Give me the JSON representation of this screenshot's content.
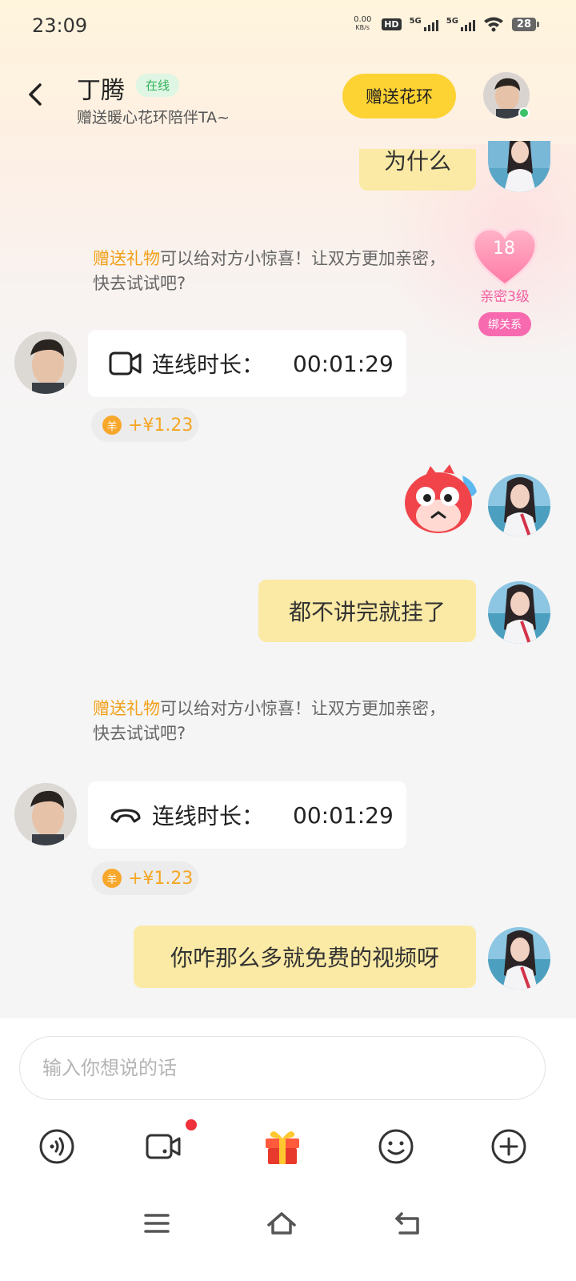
{
  "status_bar": {
    "time": "23:09",
    "net_speed_value": "0.00",
    "net_speed_unit": "KB/s",
    "hd_badge": "HD",
    "signal1_label": "5G",
    "signal2_label": "5G",
    "battery": "28"
  },
  "header": {
    "name": "丁腾",
    "online_status": "在线",
    "subtitle": "赠送暖心花环陪伴TA~",
    "gift_button": "赠送花环"
  },
  "intimacy": {
    "number": "18",
    "level": "亲密3级",
    "bind_button": "绑关系"
  },
  "messages": [
    {
      "type": "outgoing_partial",
      "text": "为什么"
    },
    {
      "type": "tip",
      "highlight": "赠送礼物",
      "text": "可以给对方小惊喜！让双方更加亲密，快去试试吧?"
    },
    {
      "type": "call",
      "icon": "video-call-icon",
      "label": "连线时长：",
      "duration": "00:01:29",
      "earning": "+¥1.23"
    },
    {
      "type": "sticker",
      "icon": "sweating-emoji-sticker"
    },
    {
      "type": "outgoing",
      "text": "都不讲完就挂了"
    },
    {
      "type": "tip",
      "highlight": "赠送礼物",
      "text": "可以给对方小惊喜！让双方更加亲密，快去试试吧?"
    },
    {
      "type": "call",
      "icon": "hangup-call-icon",
      "label": "连线时长：",
      "duration": "00:01:29",
      "earning": "+¥1.23"
    },
    {
      "type": "outgoing",
      "text": "你咋那么多就免费的视频呀"
    }
  ],
  "coin_glyph": "羊",
  "input": {
    "placeholder": "输入你想说的话"
  },
  "toolbar": [
    "voice-icon",
    "video-icon",
    "gift-icon",
    "emoji-icon",
    "plus-icon"
  ],
  "colors": {
    "accent_yellow": "#fdd233",
    "bubble_out": "#fbeaa5",
    "highlight": "#f2a019",
    "online_green": "#33b35a",
    "pink": "#f86aaf"
  }
}
